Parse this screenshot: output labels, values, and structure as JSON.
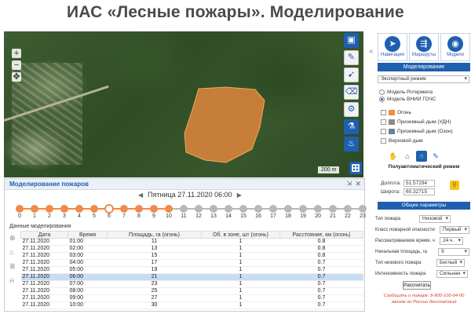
{
  "title": "ИАС «Лесные пожары». Моделирование",
  "map": {
    "scale_text": "200 m",
    "tools": [
      "briefcase-icon",
      "pencil-icon",
      "pin-icon",
      "eraser-icon",
      "gear-icon",
      "flask-icon",
      "flame-icon"
    ],
    "zoom": [
      "+",
      "−"
    ]
  },
  "bottom": {
    "panel_title": "Моделирование пожаров",
    "date_label": "Пятница 27.11.2020 06:00",
    "timeline": {
      "labels": [
        "0",
        "1",
        "2",
        "3",
        "4",
        "5",
        "6",
        "7",
        "8",
        "9",
        "10",
        "11",
        "12",
        "13",
        "14",
        "15",
        "16",
        "17",
        "18",
        "19",
        "20",
        "21",
        "22",
        "23"
      ],
      "current_index": 6,
      "progress_last_index": 10
    },
    "data_label": "Данные моделирования",
    "table": {
      "columns": [
        "Дата",
        "Время",
        "Площадь, га (огонь)",
        "Об. в зоне, шт (огонь)",
        "Расстояние, км (огонь)"
      ],
      "rows": [
        [
          "27.11.2020",
          "01:00",
          "11",
          "1",
          "0.8"
        ],
        [
          "27.11.2020",
          "02:00",
          "13",
          "1",
          "0.8"
        ],
        [
          "27.11.2020",
          "03:00",
          "15",
          "1",
          "0.8"
        ],
        [
          "27.11.2020",
          "04:00",
          "17",
          "1",
          "0.7"
        ],
        [
          "27.11.2020",
          "05:00",
          "19",
          "1",
          "0.7"
        ],
        [
          "27.11.2020",
          "06:00",
          "21",
          "1",
          "0.7"
        ],
        [
          "27.11.2020",
          "07:00",
          "23",
          "1",
          "0.7"
        ],
        [
          "27.11.2020",
          "08:00",
          "25",
          "1",
          "0.7"
        ],
        [
          "27.11.2020",
          "09:00",
          "27",
          "1",
          "0.7"
        ],
        [
          "27.11.2020",
          "10:00",
          "30",
          "1",
          "0.7"
        ]
      ],
      "selected_row": 5
    }
  },
  "right": {
    "tabs": [
      {
        "label": "Навигация",
        "icon": "navigation-icon"
      },
      {
        "label": "Маршруты",
        "icon": "routes-icon"
      },
      {
        "label": "Модели",
        "icon": "models-icon"
      }
    ],
    "section_title": "Моделирование",
    "mode_select": "Экспертный режим",
    "model_options": [
      "Модель Ротермела",
      "Модель ВНИИ ГОЧС"
    ],
    "model_selected": 1,
    "legend": [
      {
        "label": "Огонь",
        "color": "#f08a3c"
      },
      {
        "label": "Приземный дым (УДН)",
        "color": "#8a8a8a"
      },
      {
        "label": "Приземный дым (Озон)",
        "color": "#6f7fa0"
      },
      {
        "label": "Верховой дым",
        "color": ""
      }
    ],
    "mode_icons": [
      "hand-icon",
      "home-icon",
      "pointer-icon",
      "edit-icon"
    ],
    "mode_active": 2,
    "semi_mode": "Полуавтоматический режим",
    "longitude_label": "Долгота:",
    "longitude": "51.57294",
    "latitude_label": "Широта:",
    "latitude": "60.32715",
    "params_title": "Общие параметры",
    "params": [
      {
        "label": "Тип пожара",
        "value": "Низовой"
      },
      {
        "label": "Класс пожарной опасности:",
        "value": "Первый"
      },
      {
        "label": "Рассматриваемое время, ч",
        "value": "24 ч."
      },
      {
        "label": "Начальная площадь, га",
        "value": "9"
      },
      {
        "label": "Тип низового пожара",
        "value": "Беглый"
      },
      {
        "label": "Интенсивность пожара",
        "value": "Сильная"
      }
    ],
    "calc_label": "Рассчитать",
    "report_line1": "Сообщить о пожаре: 8-800-100-94-00",
    "report_line2": "звонок по России бесплатный"
  }
}
